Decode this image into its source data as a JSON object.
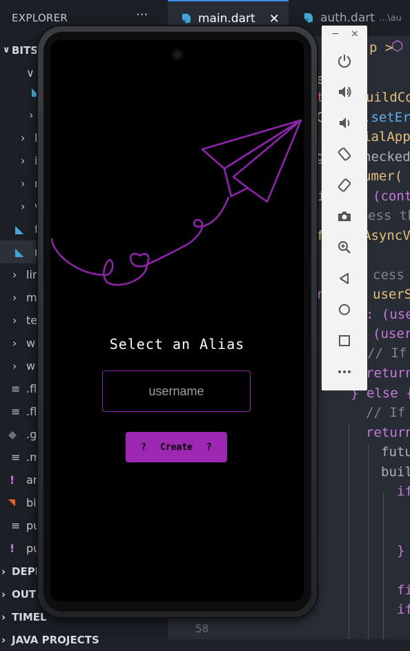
{
  "vscode": {
    "explorer_title": "EXPLORER",
    "explorer_more": "···",
    "tabs": [
      {
        "label": "main.dart",
        "close": "✕"
      },
      {
        "label": "auth.dart",
        "path": "...\\au"
      }
    ],
    "sidebar": {
      "root_label": "BITS",
      "folders": [
        "li",
        "i",
        "n",
        "v",
        "lin",
        "m",
        "te",
        "w",
        "w"
      ],
      "files": [
        "f",
        "n",
        ".fl",
        ".fl",
        ".g",
        ".m",
        "ar",
        "bi",
        "pu",
        "pu"
      ],
      "sections": [
        "DEPE",
        "OUTL",
        "TIMEL",
        "JAVA PROJECTS"
      ]
    },
    "code_fragments": [
      "p > ",
      "e",
      "uildCo",
      "t",
      ".setEr",
      "C",
      "ialApp",
      "g",
      "hecked",
      "umer(",
      "i",
      "(cont",
      "ess th",
      "f",
      "AsyncV",
      "cess t",
      "r",
      "userS",
      ": (use",
      "(user",
      "// If",
      "return",
      "} else {",
      "// If",
      "return",
      "futu",
      "buil",
      "if",
      "}",
      "fi",
      "if"
    ],
    "line_number": "58",
    "accent_color": "#3b8eea"
  },
  "app": {
    "title": "Select an Alias",
    "username_placeholder": "username",
    "username_value": "",
    "create_button": {
      "icon_left": "?",
      "label": "Create",
      "icon_right": "?"
    },
    "accent_color": "#9c27b0"
  },
  "emulator": {
    "window_minimize": "−",
    "window_close": "×",
    "buttons": [
      "power-icon",
      "volume-up-icon",
      "volume-down-icon",
      "rotate-left-icon",
      "rotate-right-icon",
      "camera-icon",
      "zoom-icon",
      "back-icon",
      "home-icon",
      "overview-icon",
      "more-icon"
    ]
  }
}
